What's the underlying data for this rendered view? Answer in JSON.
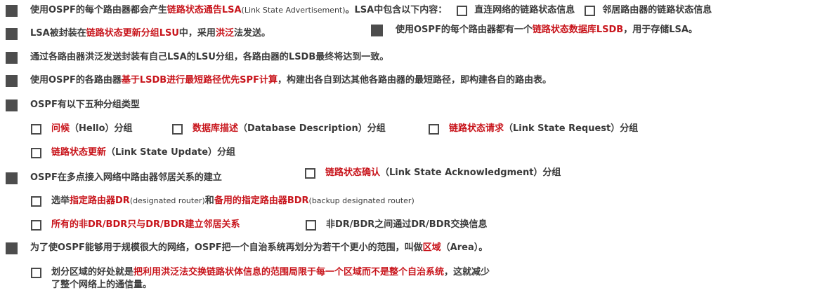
{
  "colors": {
    "text": "#3a3a3a",
    "highlight": "#c8141b",
    "bullet": "#4d4d4d"
  },
  "l1": {
    "a": "使用OSPF的每个路由器都会产生",
    "b": "链路状态通告LSA",
    "c": "(Link State Advertisement)",
    "d": "。LSA中包含以下内容：",
    "opt1": "直连网络的链路状态信息",
    "opt2": "邻居路由器的链路状态信息"
  },
  "l2": {
    "a": "LSA被封装在",
    "b": "链路状态更新分组LSU",
    "c": "中，采用",
    "d": "洪泛",
    "e": "法发送。"
  },
  "l2r": {
    "a": "使用OSPF的每个路由器都有一个",
    "b": "链路状态数据库LSDB",
    "c": "，用于存储LSA。"
  },
  "l3": {
    "a": "通过各路由器洪泛发送封装有自己LSA的LSU分组，各路由器的LSDB最终将达到一致。"
  },
  "l4": {
    "a": "使用OSPF的各路由器",
    "b": "基于LSDB进行最短路径优先SPF计算",
    "c": "，构建出各自到达其他各路由器的最短路径，即构建各自的路由表。"
  },
  "l5": {
    "a": "OSPF有以下五种分组类型"
  },
  "pk": {
    "p1r": "问候",
    "p1": "（Hello）分组",
    "p2r": "数据库描述",
    "p2": "（Database Description）分组",
    "p3r": "链路状态请求",
    "p3": "（Link State Request）分组",
    "p4r": "链路状态更新",
    "p4": "（Link State Update）分组",
    "p5r": "链路状态确认",
    "p5": "（Link State Acknowledgment）分组"
  },
  "l7": {
    "a": "OSPF在多点接入网络中路由器邻居关系的建立"
  },
  "dr": {
    "a": "选举",
    "b": "指定路由器DR",
    "c": "(designated router)",
    "d": "和",
    "e": "备用的指定路由器BDR",
    "f": "(backup designated router)"
  },
  "nb": {
    "a": "所有的非DR/BDR只与DR/BDR建立邻居关系",
    "b": "非DR/BDR之间通过DR/BDR交换信息"
  },
  "area": {
    "a": "为了使OSPF能够用于规模很大的网络，OSPF把一个自治系统再划分为若干个更小的范围，叫做",
    "b": "区域",
    "c": "（Area）。"
  },
  "benefit": {
    "a": "划分区域的好处就是",
    "b": "把利用洪泛法交换链路状体信息的范围局限于每一个区域而不是整个自治系统",
    "c": "，这就减少",
    "d": "了整个网络上的通信量。"
  }
}
